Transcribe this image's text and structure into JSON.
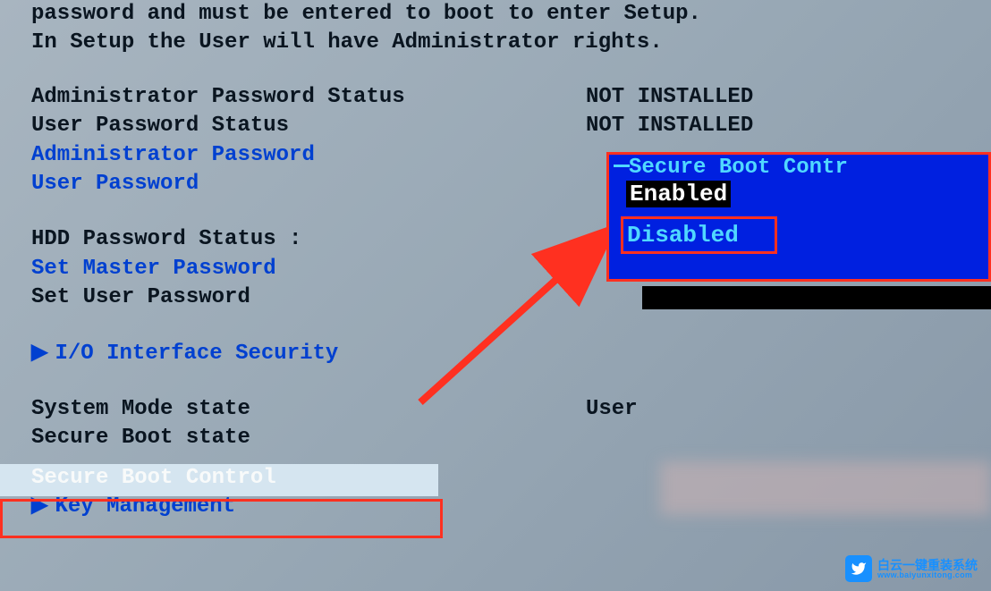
{
  "header": {
    "line1": "password and must be entered to boot to enter Setup.",
    "line2": "In Setup the User will have Administrator rights."
  },
  "menu": {
    "admin_pass_status": {
      "label": "Administrator Password Status",
      "value": "NOT INSTALLED"
    },
    "user_pass_status": {
      "label": "User Password Status",
      "value": "NOT INSTALLED"
    },
    "admin_password": {
      "label": "Administrator Password"
    },
    "user_password": {
      "label": "User Password"
    },
    "hdd_pass_status": {
      "label": "HDD Password Status   :"
    },
    "set_master_password": {
      "label": "Set Master Password"
    },
    "set_user_password": {
      "label": "Set User Password"
    },
    "io_interface_security": {
      "label": "I/O Interface Security"
    },
    "system_mode_state": {
      "label": "System Mode state",
      "value": "User"
    },
    "secure_boot_state": {
      "label": "Secure Boot state",
      "value": ""
    },
    "secure_boot_control": {
      "label": "Secure Boot Control"
    },
    "key_management": {
      "label": "Key Management"
    }
  },
  "popup": {
    "title": "Secure Boot Contr",
    "option1": "Enabled",
    "option2": "Disabled"
  },
  "watermark": {
    "cn_text": "白云一键重装系统",
    "url": "www.baiyunxitong.com"
  }
}
